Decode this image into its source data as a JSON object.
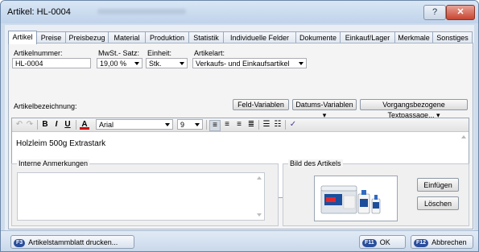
{
  "window": {
    "title": "Artikel: HL-0004",
    "help_glyph": "?",
    "close_glyph": "✕"
  },
  "tabs": [
    {
      "label": "Artikel"
    },
    {
      "label": "Preise"
    },
    {
      "label": "Preisbezug"
    },
    {
      "label": "Material"
    },
    {
      "label": "Produktion"
    },
    {
      "label": "Statistik"
    },
    {
      "label": "Individuelle Felder"
    },
    {
      "label": "Dokumente"
    },
    {
      "label": "Einkauf/Lager"
    },
    {
      "label": "Merkmale"
    },
    {
      "label": "Sonstiges"
    }
  ],
  "fields": {
    "artikelnummer_label": "Artikelnummer:",
    "artikelnummer_value": "HL-0004",
    "mwst_label": "MwSt.- Satz:",
    "mwst_value": "19,00 %",
    "einheit_label": "Einheit:",
    "einheit_value": "Stk.",
    "artikelart_label": "Artikelart:",
    "artikelart_value": "Verkaufs- und Einkaufsartikel",
    "bezeichnung_label": "Artikelbezeichnung:"
  },
  "buttons": {
    "feld_variablen": "Feld-Variablen",
    "datums_variablen": "Datums-Variablen ▾",
    "vorgang_textpassage": "Vorgangsbezogene Textpassage... ▾",
    "einfuegen": "Einfügen",
    "loeschen": "Löschen"
  },
  "editor": {
    "font_name": "Arial",
    "font_size": "9",
    "text": "Holzleim        500g Extrastark"
  },
  "groups": {
    "interne_anmerkungen": "Interne Anmerkungen",
    "bild_des_artikels": "Bild des Artikels"
  },
  "statusbar": {
    "print_key": "F3",
    "print_label": "Artikelstammblatt drucken...",
    "ok_key": "F11",
    "ok_label": "OK",
    "cancel_key": "F12",
    "cancel_label": "Abbrechen"
  },
  "colors": {
    "accent": "#2a4e9c",
    "close": "#c7452f",
    "titlebar": "#cfdcec"
  }
}
